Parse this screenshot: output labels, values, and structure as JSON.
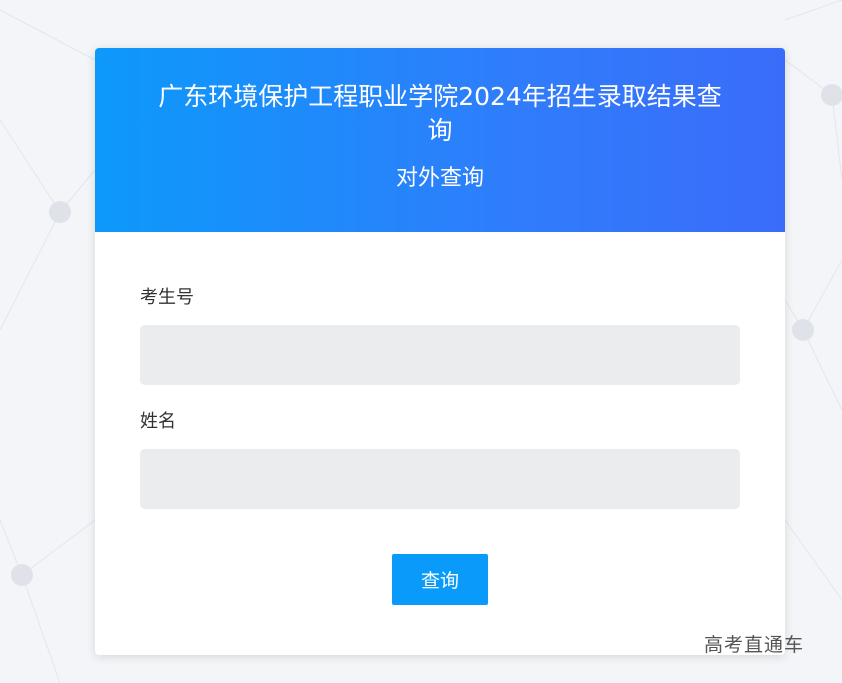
{
  "header": {
    "title": "广东环境保护工程职业学院2024年招生录取结果查询",
    "subtitle": "对外查询"
  },
  "form": {
    "exam_number": {
      "label": "考生号",
      "value": "",
      "placeholder": ""
    },
    "name": {
      "label": "姓名",
      "value": "",
      "placeholder": ""
    },
    "submit_label": "查询"
  },
  "watermark": "高考直通车",
  "colors": {
    "header_gradient_start": "#0d99fb",
    "header_gradient_end": "#3a6cfa",
    "button": "#0a9bfa",
    "input_bg": "#ebecee"
  }
}
